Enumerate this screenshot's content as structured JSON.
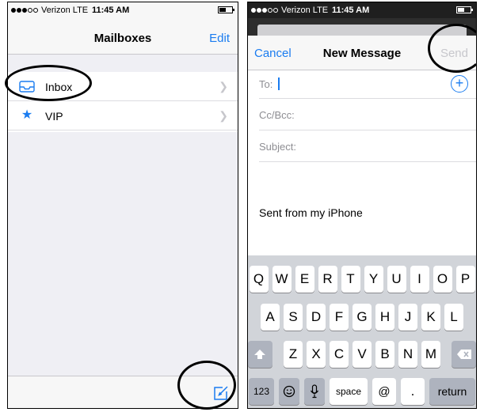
{
  "left_phone": {
    "status": {
      "carrier": "Verizon",
      "network": "LTE",
      "time": "11:45 AM"
    },
    "nav": {
      "title": "Mailboxes",
      "edit_label": "Edit"
    },
    "mailboxes": [
      {
        "label": "Inbox",
        "icon": "inbox-tray-icon"
      },
      {
        "label": "VIP",
        "icon": "star-icon"
      }
    ],
    "toolbar": {
      "compose_icon": "compose-icon"
    }
  },
  "right_phone": {
    "status": {
      "carrier": "Verizon",
      "network": "LTE",
      "time": "11:45 AM"
    },
    "nav": {
      "cancel_label": "Cancel",
      "title": "New Message",
      "send_label": "Send"
    },
    "fields": {
      "to_label": "To:",
      "cc_label": "Cc/Bcc:",
      "subject_label": "Subject:"
    },
    "body": {
      "signature": "Sent from my iPhone"
    },
    "keyboard": {
      "row1": [
        "Q",
        "W",
        "E",
        "R",
        "T",
        "Y",
        "U",
        "I",
        "O",
        "P"
      ],
      "row2": [
        "A",
        "S",
        "D",
        "F",
        "G",
        "H",
        "J",
        "K",
        "L"
      ],
      "row3": [
        "Z",
        "X",
        "C",
        "V",
        "B",
        "N",
        "M"
      ],
      "numbers_label": "123",
      "space_label": "space",
      "at_label": "@",
      "period_label": ".",
      "return_label": "return"
    }
  },
  "colors": {
    "accent": "#1a7cf0",
    "disabled": "#c7c7cc",
    "keyboard_bg": "#d1d4d9"
  }
}
